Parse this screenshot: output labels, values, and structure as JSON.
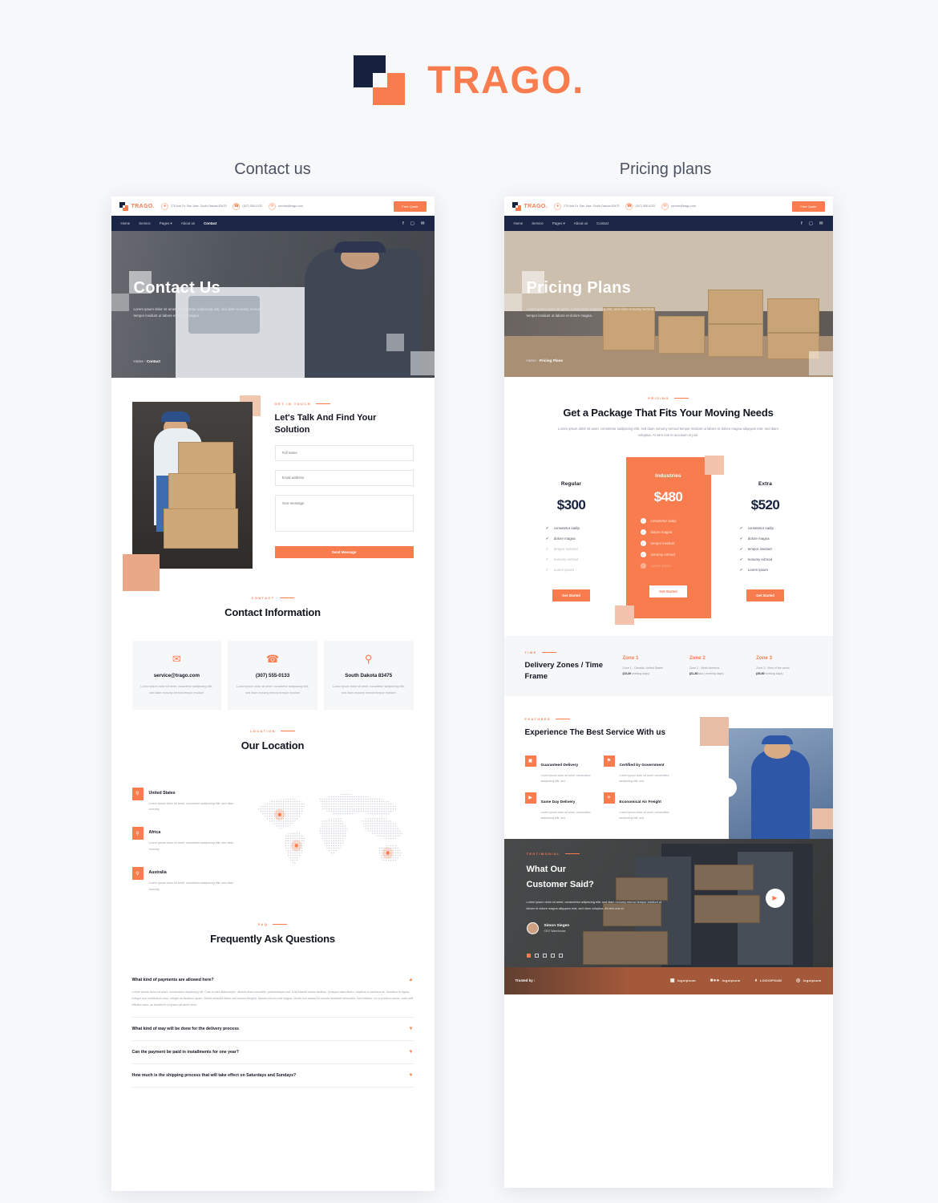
{
  "brand": {
    "name": "TRAGO.",
    "logo_icon": "trago-squares-logo",
    "color": "#f97c4e",
    "dark": "#16213f"
  },
  "columns": [
    {
      "title": "Contact us"
    },
    {
      "title": "Pricing plans"
    }
  ],
  "topbar": {
    "logo_name": "TRAGO.",
    "address": "275 Ash Dr. San Jose, South Dakota 83475",
    "phone": "(307) 555-0133",
    "email": "service@trago.com",
    "cta": "Free Quote",
    "icons": {
      "location": "location-pin-icon",
      "phone": "phone-icon",
      "mail": "mail-icon"
    }
  },
  "nav": {
    "items": [
      "Home",
      "Service",
      "Pages",
      "About us",
      "Contact"
    ],
    "active_left": "Contact",
    "active_right": "",
    "social": [
      "facebook-icon",
      "instagram-icon",
      "twitter-icon"
    ]
  },
  "contact_page": {
    "hero": {
      "title": "Contact Us",
      "subtitle": "Lorem ipsum dolor sit amet, consectetur adipiscing elitr, sed diam nonumy eirmod tempor invidunt ut labore et dolore magna.",
      "breadcrumb_home": "Home -",
      "breadcrumb_current": "Contact"
    },
    "talk": {
      "eyebrow": "GET IN TOUCH",
      "title": "Let's Talk And Find Your Solution",
      "fields": {
        "fullname_placeholder": "Full name",
        "fullname_value": "",
        "email_placeholder": "Email address",
        "email_value": "",
        "message_placeholder": "Your message",
        "message_value": ""
      },
      "submit": "Send Message"
    },
    "info": {
      "eyebrow": "CONTACT",
      "title": "Contact Information",
      "cards": [
        {
          "icon": "mail-icon",
          "value": "service@trago.com",
          "desc": "Lorem ipsum dolor sit amet, consetetur sadipscing elitr, sed diam nonumy eirmod tempor invidunt"
        },
        {
          "icon": "phone-icon",
          "value": "(307) 555-0133",
          "desc": "Lorem ipsum dolor sit amet, consetetur sadipscing elitr, sed diam nonumy eirmod tempor invidunt"
        },
        {
          "icon": "location-pin-icon",
          "value": "South Dakota 83475",
          "desc": "Lorem ipsum dolor sit amet, consetetur sadipscing elitr, sed diam nonumy eirmod tempor invidunt"
        }
      ]
    },
    "location": {
      "eyebrow": "LOCATION",
      "title": "Our Location",
      "places": [
        {
          "name": "United States",
          "desc": "Lorem ipsum dolor sit amet, consetetur sadipscing elitr, sed diam nonumy"
        },
        {
          "name": "Africa",
          "desc": "Lorem ipsum dolor sit amet, consetetur sadipscing elitr, sed diam nonumy"
        },
        {
          "name": "Australia",
          "desc": "Lorem ipsum dolor sit amet, consetetur sadipscing elitr, sed diam nonumy"
        }
      ]
    },
    "faq": {
      "eyebrow": "FAQ",
      "title": "Frequently Ask Questions",
      "items": [
        {
          "q": "What kind of payments are allowed here?",
          "open": true,
          "chevron": "chevron-up-icon",
          "a": "Lorem ipsum dolor sit amet, consectetur adipiscing elit. Cras in nisl ullamcorper, ultrices enim convallis, pellentesque erat. Duis blandit luctus facilisis. Quisque diam libero, dapibus a maximus ac, faucibus et ligula. Integer non vestibulum eros, integer at faucibus quam. Morbi vehicula libero sed cursus fringilla. Mauris rutrum erat magna. Morbi non massa id mauris hendrerit venenatis. Sed efficitur, ex ut pretium varius, ante velit efficitur risus, ac hendrerit mi ipsum sit amet enim."
        },
        {
          "q": "What kind of way will be done for the delivery process",
          "open": false,
          "chevron": "chevron-down-icon",
          "a": ""
        },
        {
          "q": "Can the payment be paid in installments for one year?",
          "open": false,
          "chevron": "chevron-down-icon",
          "a": ""
        },
        {
          "q": "How much is the shipping process that will take effect on Saturdays and Sundays?",
          "open": false,
          "chevron": "chevron-down-icon",
          "a": ""
        }
      ]
    }
  },
  "pricing_page": {
    "hero": {
      "title": "Pricing Plans",
      "subtitle": "Lorem ipsum dolor sit amet, consectetur adipiscing elitr, sed diam nonumy eirmod tempor invidunt ut labore et dolore magna.",
      "breadcrumb_home": "Home -",
      "breadcrumb_current": "Pricing Plans"
    },
    "pricing": {
      "eyebrow": "PRICING",
      "title": "Get a Package That Fits Your Moving Needs",
      "subtitle": "Lorem ipsum dolor sit amet, consetetur sadipscing elitr, sed diam nonumy eirmod tempor invidunt ut labore et dolore magna aliquyam erat, sed diam voluptua. At vero eos et accusam et just.",
      "plans": [
        {
          "name": "Regular",
          "price": "$300",
          "featured": false,
          "cta": "Get Started",
          "features": [
            {
              "label": "consetetur sadip",
              "dim": false
            },
            {
              "label": "dolore magna",
              "dim": false
            },
            {
              "label": "tempor invidunt",
              "dim": true
            },
            {
              "label": "nonumy eirmod",
              "dim": true
            },
            {
              "label": "Lorem ipsum",
              "dim": true
            }
          ]
        },
        {
          "name": "Industries",
          "price": "$480",
          "featured": true,
          "cta": "Get Started",
          "features": [
            {
              "label": "consetetur sadip",
              "dim": false
            },
            {
              "label": "dolore magna",
              "dim": false
            },
            {
              "label": "tempor invidunt",
              "dim": false
            },
            {
              "label": "nonumy eirmod",
              "dim": false
            },
            {
              "label": "Lorem ipsum",
              "dim": true
            }
          ]
        },
        {
          "name": "Extra",
          "price": "$520",
          "featured": false,
          "cta": "Get Started",
          "features": [
            {
              "label": "consetetur sadip",
              "dim": false
            },
            {
              "label": "dolore magna",
              "dim": false
            },
            {
              "label": "tempor invidunt",
              "dim": false
            },
            {
              "label": "nonumy eirmod",
              "dim": false
            },
            {
              "label": "Lorem ipsum",
              "dim": false
            }
          ]
        }
      ]
    },
    "zones": {
      "eyebrow": "TIME",
      "title": "Delivery Zones / Time Frame",
      "items": [
        {
          "title": "Zone 1",
          "line1": "Zone 1 - Canada, United States",
          "days": "(10-20",
          "line2": " working days)"
        },
        {
          "title": "Zone 2",
          "line1": "Zone 2 - North America,",
          "days": "(21-26",
          "line2": "Asia ( working days)"
        },
        {
          "title": "Zone 3",
          "line1": "Zone 3 - Rest of the world",
          "days": "(25-30",
          "line2": " working days)"
        }
      ]
    },
    "features": {
      "eyebrow": "FEATURES",
      "title": "Experience The Best Service With us",
      "items": [
        {
          "icon": "box-check-icon",
          "title": "Guaranteed Delivery",
          "desc": "Lorem ipsum dolor sit amet, consectetur sadipscing elitr, sed"
        },
        {
          "icon": "certificate-icon",
          "title": "Certified by Government",
          "desc": "Lorem ipsum dolor sit amet, consectetur sadipscing elitr, sed"
        },
        {
          "icon": "truck-fast-icon",
          "title": "Same Day Delivery",
          "desc": "Lorem ipsum dolor sit amet, consectetur sadipscing elitr, sed"
        },
        {
          "icon": "plane-icon",
          "title": "Economical Air Freight",
          "desc": "Lorem ipsum dolor sit amet, consectetur sadipscing elitr, sed"
        }
      ],
      "play_icon": "play-button-icon"
    },
    "testimonial": {
      "eyebrow": "TESTIMONIAL",
      "title_line1": "What Our",
      "title_line2": "Customer Said?",
      "quote": "Lorem ipsum dolor sit amet, consectetur adipiscing elitr, sed diam nonumy eirmod tempor invidunt ut labore et dolore magna aliquyam erat, sed diam voluptua. At vero eos et.",
      "author": "Simon Siegen",
      "role": "CEO Warehouse",
      "play_icon": "play-button-icon",
      "dots": [
        true,
        false,
        false,
        false,
        false
      ]
    },
    "trusted": {
      "label": "Trusted by :",
      "logos": [
        "logoipsum",
        "logoipsum",
        "LOGOIPSUM",
        "logoipsum"
      ]
    }
  }
}
